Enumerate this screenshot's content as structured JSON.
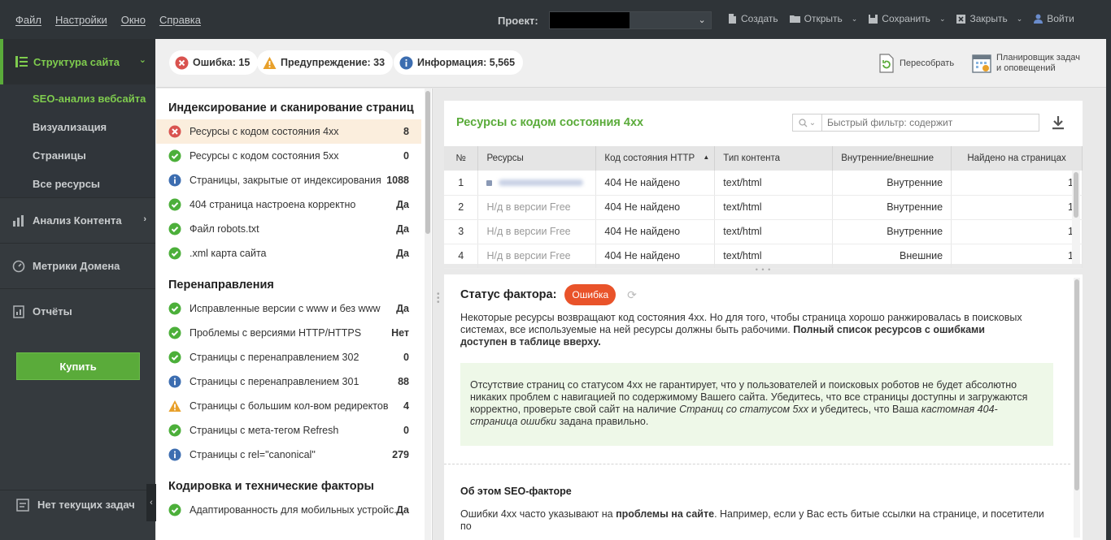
{
  "menubar": {
    "items": [
      "Файл",
      "Настройки",
      "Окно",
      "Справка"
    ],
    "project_label": "Проект:",
    "tools": [
      {
        "label": "Создать",
        "icon": "new-file-icon",
        "dropdown": false
      },
      {
        "label": "Открыть",
        "icon": "folder-icon",
        "dropdown": true
      },
      {
        "label": "Сохранить",
        "icon": "save-icon",
        "dropdown": true
      },
      {
        "label": "Закрыть",
        "icon": "close-icon",
        "dropdown": true
      },
      {
        "label": "Войти",
        "icon": "user-icon",
        "dropdown": false
      }
    ]
  },
  "sidebar": {
    "main_label": "Структура сайта",
    "sub_items": [
      "SEO-анализ вебсайта",
      "Визуализация",
      "Страницы",
      "Все ресурсы"
    ],
    "sections": [
      {
        "label": "Анализ Контента",
        "icon": "bar-chart-icon",
        "chevron": true
      },
      {
        "label": "Метрики Домена",
        "icon": "gauge-icon",
        "chevron": false
      },
      {
        "label": "Отчёты",
        "icon": "report-icon",
        "chevron": false
      }
    ],
    "buy_label": "Купить",
    "tasks_label": "Нет текущих задач"
  },
  "summary": {
    "error": "Ошибка: 15",
    "warning": "Предупреждение: 33",
    "info": "Информация: 5,565",
    "rebuild": "Пересобрать",
    "scheduler_line1": "Планировщик задач",
    "scheduler_line2": "и оповещений"
  },
  "checklist": {
    "groups": [
      {
        "title": "Индексирование и сканирование страниц",
        "rows": [
          {
            "status": "error",
            "label": "Ресурсы с кодом состояния 4xx",
            "value": "8",
            "selected": true
          },
          {
            "status": "ok",
            "label": "Ресурсы с кодом состояния 5xx",
            "value": "0"
          },
          {
            "status": "info",
            "label": "Страницы, закрытые от индексирования",
            "value": "1088"
          },
          {
            "status": "ok",
            "label": "404 страница настроена корректно",
            "value": "Да"
          },
          {
            "status": "ok",
            "label": "Файл robots.txt",
            "value": "Да"
          },
          {
            "status": "ok",
            "label": ".xml карта сайта",
            "value": "Да"
          }
        ]
      },
      {
        "title": "Перенаправления",
        "rows": [
          {
            "status": "ok",
            "label": "Исправленные версии с www и без www",
            "value": "Да"
          },
          {
            "status": "ok",
            "label": "Проблемы с версиями HTTP/HTTPS",
            "value": "Нет"
          },
          {
            "status": "ok",
            "label": "Страницы с перенаправлением 302",
            "value": "0"
          },
          {
            "status": "info",
            "label": "Страницы с перенаправлением 301",
            "value": "88"
          },
          {
            "status": "warning",
            "label": "Страницы с большим кол-вом редиректов",
            "value": "4"
          },
          {
            "status": "ok",
            "label": "Страницы с мета-тегом Refresh",
            "value": "0"
          },
          {
            "status": "info",
            "label": "Страницы с rel=\"canonical\"",
            "value": "279"
          }
        ]
      },
      {
        "title": "Кодировка и технические факторы",
        "rows": [
          {
            "status": "ok",
            "label": "Адаптированность для мобильных устройс...",
            "value": "Да"
          }
        ]
      }
    ]
  },
  "resources": {
    "title": "Ресурсы с кодом состояния 4xx",
    "filter_placeholder": "Быстрый фильтр: содержит",
    "columns": [
      "№",
      "Ресурсы",
      "Код состояния HTTP",
      "Тип контента",
      "Внутренние/внешние",
      "Найдено на страницах"
    ],
    "rows": [
      {
        "n": "1",
        "resource": "",
        "code": "404 Не найдено",
        "type": "text/html",
        "scope": "Внутренние",
        "found": "1"
      },
      {
        "n": "2",
        "resource": "Н/д в версии Free",
        "code": "404 Не найдено",
        "type": "text/html",
        "scope": "Внутренние",
        "found": "1"
      },
      {
        "n": "3",
        "resource": "Н/д в версии Free",
        "code": "404 Не найдено",
        "type": "text/html",
        "scope": "Внутренние",
        "found": "1"
      },
      {
        "n": "4",
        "resource": "Н/д в версии Free",
        "code": "404 Не найдено",
        "type": "text/html",
        "scope": "Внешние",
        "found": "1"
      }
    ]
  },
  "detail": {
    "status_label": "Статус фактора:",
    "status_value": "Ошибка",
    "desc_plain": "Некоторые ресурсы возвращают код состояния 4xx. Но для того, чтобы страница хорошо ранжировалась в поисковых системах, все используемые на ней ресурсы должны быть рабочими. ",
    "desc_bold": "Полный список ресурсов с ошибками доступен в таблице вверху.",
    "note_1": "Отсутствие страниц со статусом 4xx не гарантирует, что у пользователей и поисковых роботов не будет абсолютно никаких проблем с навигацией по содержимому Вашего сайта. Убедитесь, что все страницы доступны и загружаются корректно, проверьте свой сайт на наличие ",
    "note_italic_1": "Страниц со статусом 5xx",
    "note_2": " и убедитесь, что Ваша ",
    "note_italic_2": "кастомная 404-страница ошибки",
    "note_3": " задана правильно.",
    "about_title": "Об этом SEO-факторе",
    "about_1": "Ошибки 4xx часто указывают на ",
    "about_bold": "проблемы на сайте",
    "about_2": ". Например, если у Вас есть битые ссылки на странице, и посетители по"
  },
  "colors": {
    "accent_green": "#5aab3a",
    "error": "#d9534f",
    "warning": "#e8a02a",
    "info": "#3c6db0",
    "ok": "#4caf3a"
  }
}
